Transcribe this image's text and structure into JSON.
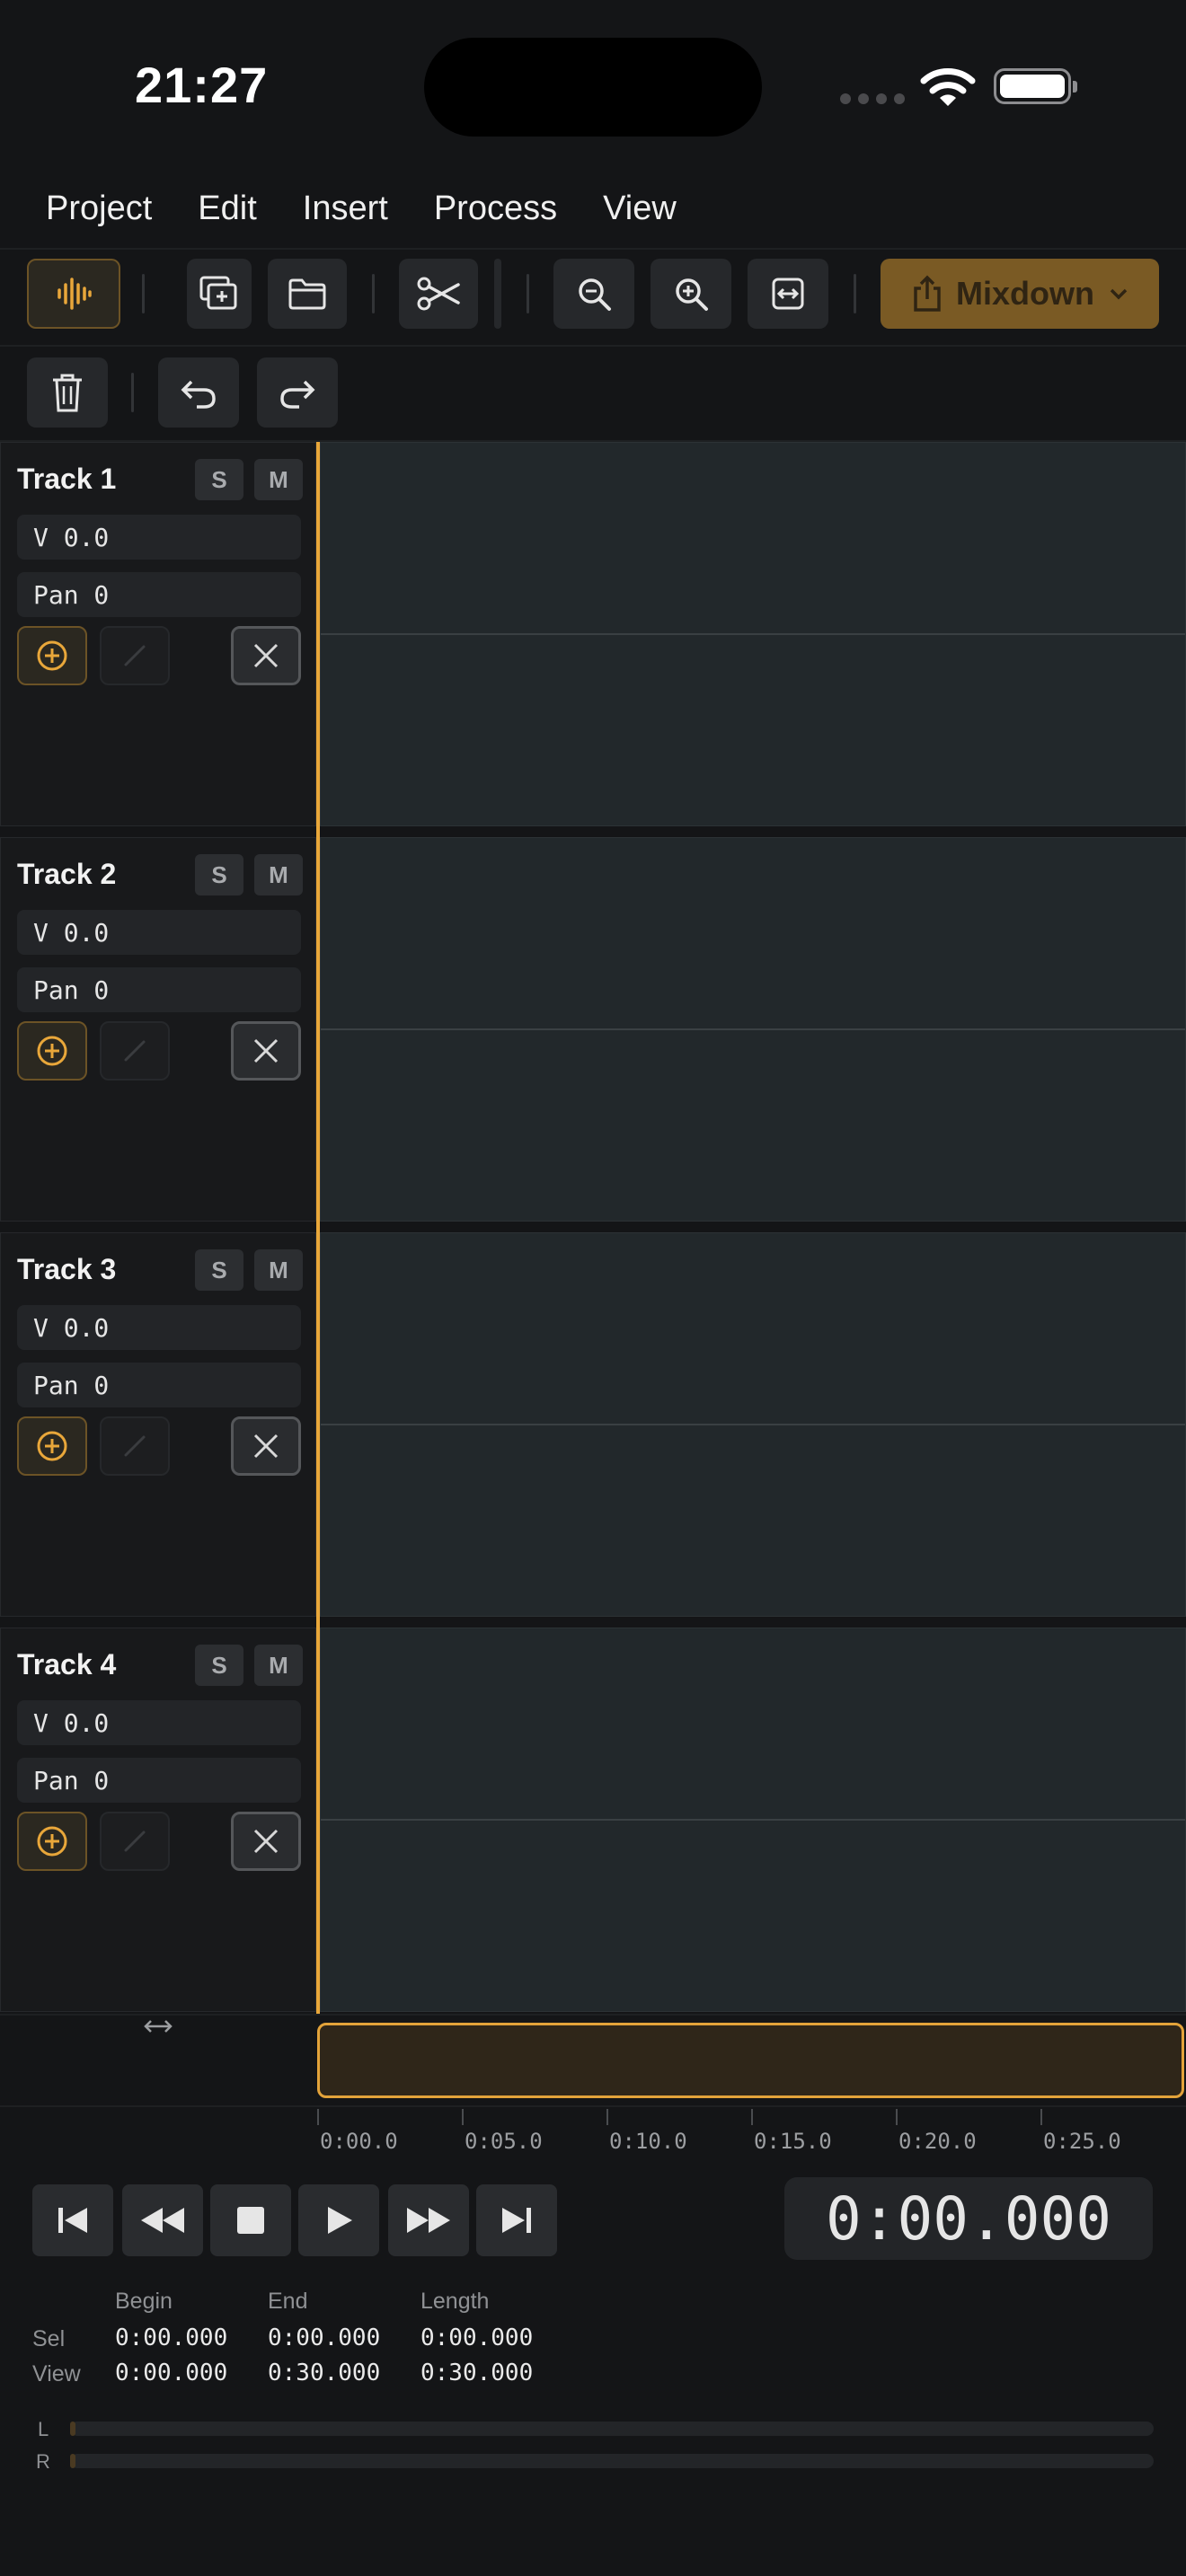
{
  "status_bar": {
    "time": "21:27"
  },
  "menu": [
    "Project",
    "Edit",
    "Insert",
    "Process",
    "View"
  ],
  "toolbar": {
    "mixdown_label": "Mixdown",
    "icons": [
      "waveform-icon",
      "add-clip-icon",
      "folder-icon",
      "scissors-icon",
      "zoom-out-icon",
      "zoom-in-icon",
      "fit-width-icon",
      "share-icon",
      "trash-icon",
      "undo-icon",
      "redo-icon"
    ]
  },
  "tracks": [
    {
      "name": "Track 1",
      "solo": "S",
      "mute": "M",
      "volume": "V 0.0",
      "pan": "Pan 0"
    },
    {
      "name": "Track 2",
      "solo": "S",
      "mute": "M",
      "volume": "V 0.0",
      "pan": "Pan 0"
    },
    {
      "name": "Track 3",
      "solo": "S",
      "mute": "M",
      "volume": "V 0.0",
      "pan": "Pan 0"
    },
    {
      "name": "Track 4",
      "solo": "S",
      "mute": "M",
      "volume": "V 0.0",
      "pan": "Pan 0"
    }
  ],
  "timeline": {
    "ticks": [
      "0:00.0",
      "0:05.0",
      "0:10.0",
      "0:15.0",
      "0:20.0",
      "0:25.0"
    ]
  },
  "transport": {
    "clock": "0:00.000"
  },
  "selection_info": {
    "headers": {
      "begin": "Begin",
      "end": "End",
      "length": "Length"
    },
    "rows": [
      {
        "label": "Sel",
        "begin": "0:00.000",
        "end": "0:00.000",
        "length": "0:00.000"
      },
      {
        "label": "View",
        "begin": "0:00.000",
        "end": "0:30.000",
        "length": "0:30.000"
      }
    ]
  },
  "meters": {
    "left_label": "L",
    "right_label": "R",
    "left_level": 0,
    "right_level": 0
  },
  "colors": {
    "accent": "#E9A73A",
    "background": "#141517",
    "lane": "#22282B"
  }
}
